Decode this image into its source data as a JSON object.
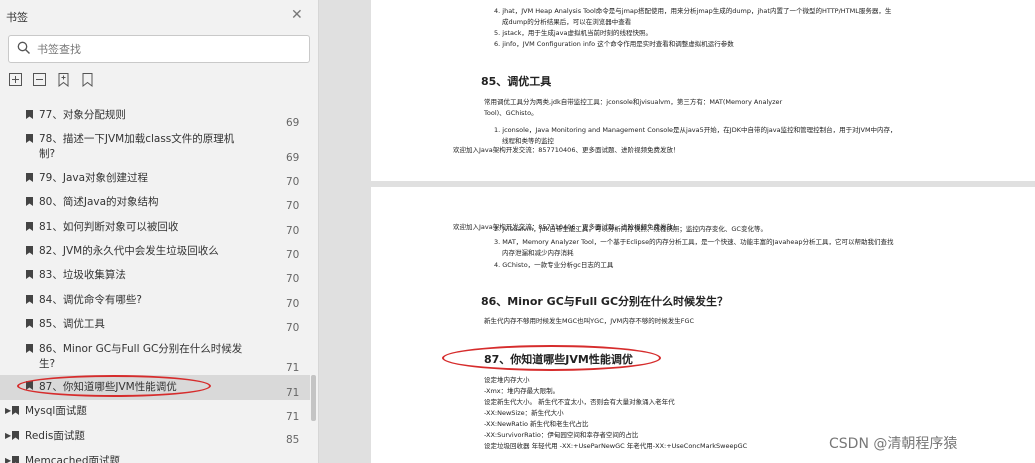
{
  "sidebar": {
    "title": "书签",
    "search_placeholder": "书签查找",
    "items": [
      {
        "label": "77、对象分配规则",
        "page": "69"
      },
      {
        "label": "78、描述一下JVM加载class文件的原理机制?",
        "label_line1": "78、描述一下JVM加载class文件的原理机",
        "label_line2": "制?",
        "page": "69"
      },
      {
        "label": "79、Java对象创建过程",
        "page": "70"
      },
      {
        "label": "80、简述Java的对象结构",
        "page": "70"
      },
      {
        "label": "81、如何判断对象可以被回收",
        "page": "70"
      },
      {
        "label": "82、JVM的永久代中会发生垃圾回收么",
        "page": "70"
      },
      {
        "label": "83、垃圾收集算法",
        "page": "70"
      },
      {
        "label": "84、调优命令有哪些?",
        "page": "70"
      },
      {
        "label": "85、调优工具",
        "page": "70"
      },
      {
        "label": "86、Minor GC与Full GC分别在什么时候发生?",
        "label_line1": "86、Minor GC与Full GC分别在什么时候发",
        "label_line2": "生?",
        "page": "71"
      },
      {
        "label": "87、你知道哪些JVM性能调优",
        "page": "71",
        "selected": true
      }
    ],
    "groups": [
      {
        "label": "Mysql面试题",
        "page": "71"
      },
      {
        "label": "Redis面试题",
        "page": "85"
      },
      {
        "label": "Memcached面试题",
        "page": ""
      }
    ]
  },
  "doc": {
    "page1": {
      "lines": [
        "4. jhat，JVM Heap Analysis Tool命令是与jmap搭配使用，用来分析jmap生成的dump，jhat内置了一个微型的HTTP/HTML服务器，生",
        "成dump的分析结果后，可以在浏览器中查看",
        "5. jstack，用于生成java虚拟机当前时刻的线程快照。",
        "6. jinfo，JVM Configuration info 这个命令作用是实时查看和调整虚拟机运行参数"
      ],
      "heading": "85、调优工具",
      "body1": "常用调优工具分为两类,jdk自带监控工具：jconsole和jvisualvm，第三方有：MAT(Memory Analyzer",
      "body2": "Tool)、GChisto。",
      "item1a": "1. jconsole，Java Monitoring and Management Console是从java5开始，在JDK中自带的java监控和管理控制台，用于对JVM中内存，",
      "item1b": "线程和类等的监控",
      "footer": "欢迎加入Java架构开发交流：857710406、更多面试题、进阶视频免费发放！"
    },
    "page2": {
      "header_overlap": "欢迎加入Java架构开发交流：857710406、更多面试题、进阶视频免费发放！",
      "line2": "2. jvisualvm，jdk自带全能工具，可以分析内存快照、线程快照；监控内存变化、GC变化等。",
      "line3a": "3. MAT，Memory Analyzer Tool，一个基于Eclipse的内存分析工具，是一个快速、功能丰富的Javaheap分析工具，它可以帮助我们查找",
      "line3b": "内存泄漏和减少内存消耗",
      "line4": "4. GChisto，一款专业分析gc日志的工具",
      "heading86": "86、Minor GC与Full GC分别在什么时候发生？",
      "body86": "新生代内存不够用时候发生MGC也叫YGC，JVM内存不够的时候发生FGC",
      "heading87": "87、你知道哪些JVM性能调优",
      "lines87": [
        "设定堆内存大小",
        "-Xmx：堆内存最大限制。",
        "设定新生代大小。 新生代不宜太小，否则会有大量对象涌入老年代",
        "-XX:NewSize：新生代大小",
        "-XX:NewRatio 新生代和老生代占比",
        "-XX:SurvivorRatio：伊甸园空间和幸存者空间的占比",
        "设定垃圾回收器 年轻代用 -XX:+UseParNewGC 年老代用-XX:+UseConcMarkSweepGC"
      ]
    }
  },
  "watermark": "CSDN @清朝程序猿",
  "colors": {
    "highlight": "#d62c2c",
    "selected_row": "#d9d9d9",
    "sidebar_bg": "#f2f2f2"
  }
}
